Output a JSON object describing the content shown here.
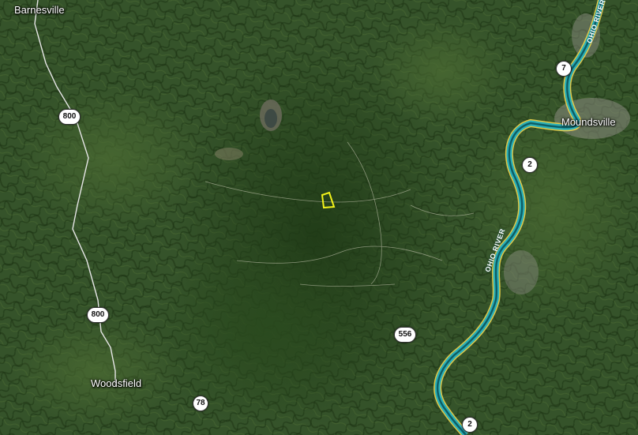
{
  "map": {
    "places": {
      "barnesville": "Barnesville",
      "moundsville": "Moundsville",
      "woodsfield": "Woodsfield"
    },
    "routes": {
      "r800_top": "800",
      "r800_bottom": "800",
      "r7": "7",
      "r2_top": "2",
      "r2_bottom": "2",
      "r556": "556",
      "r78": "78"
    },
    "river": {
      "label_top": "OHIO RIVER",
      "label_mid": "OHIO RIVER",
      "color": "#2bb0b8"
    },
    "colors": {
      "terrain": "#2f4a22",
      "highway_outline": "#f2d44a",
      "parcel_outline": "#f2f21a",
      "road": "#e8e8e8"
    }
  }
}
